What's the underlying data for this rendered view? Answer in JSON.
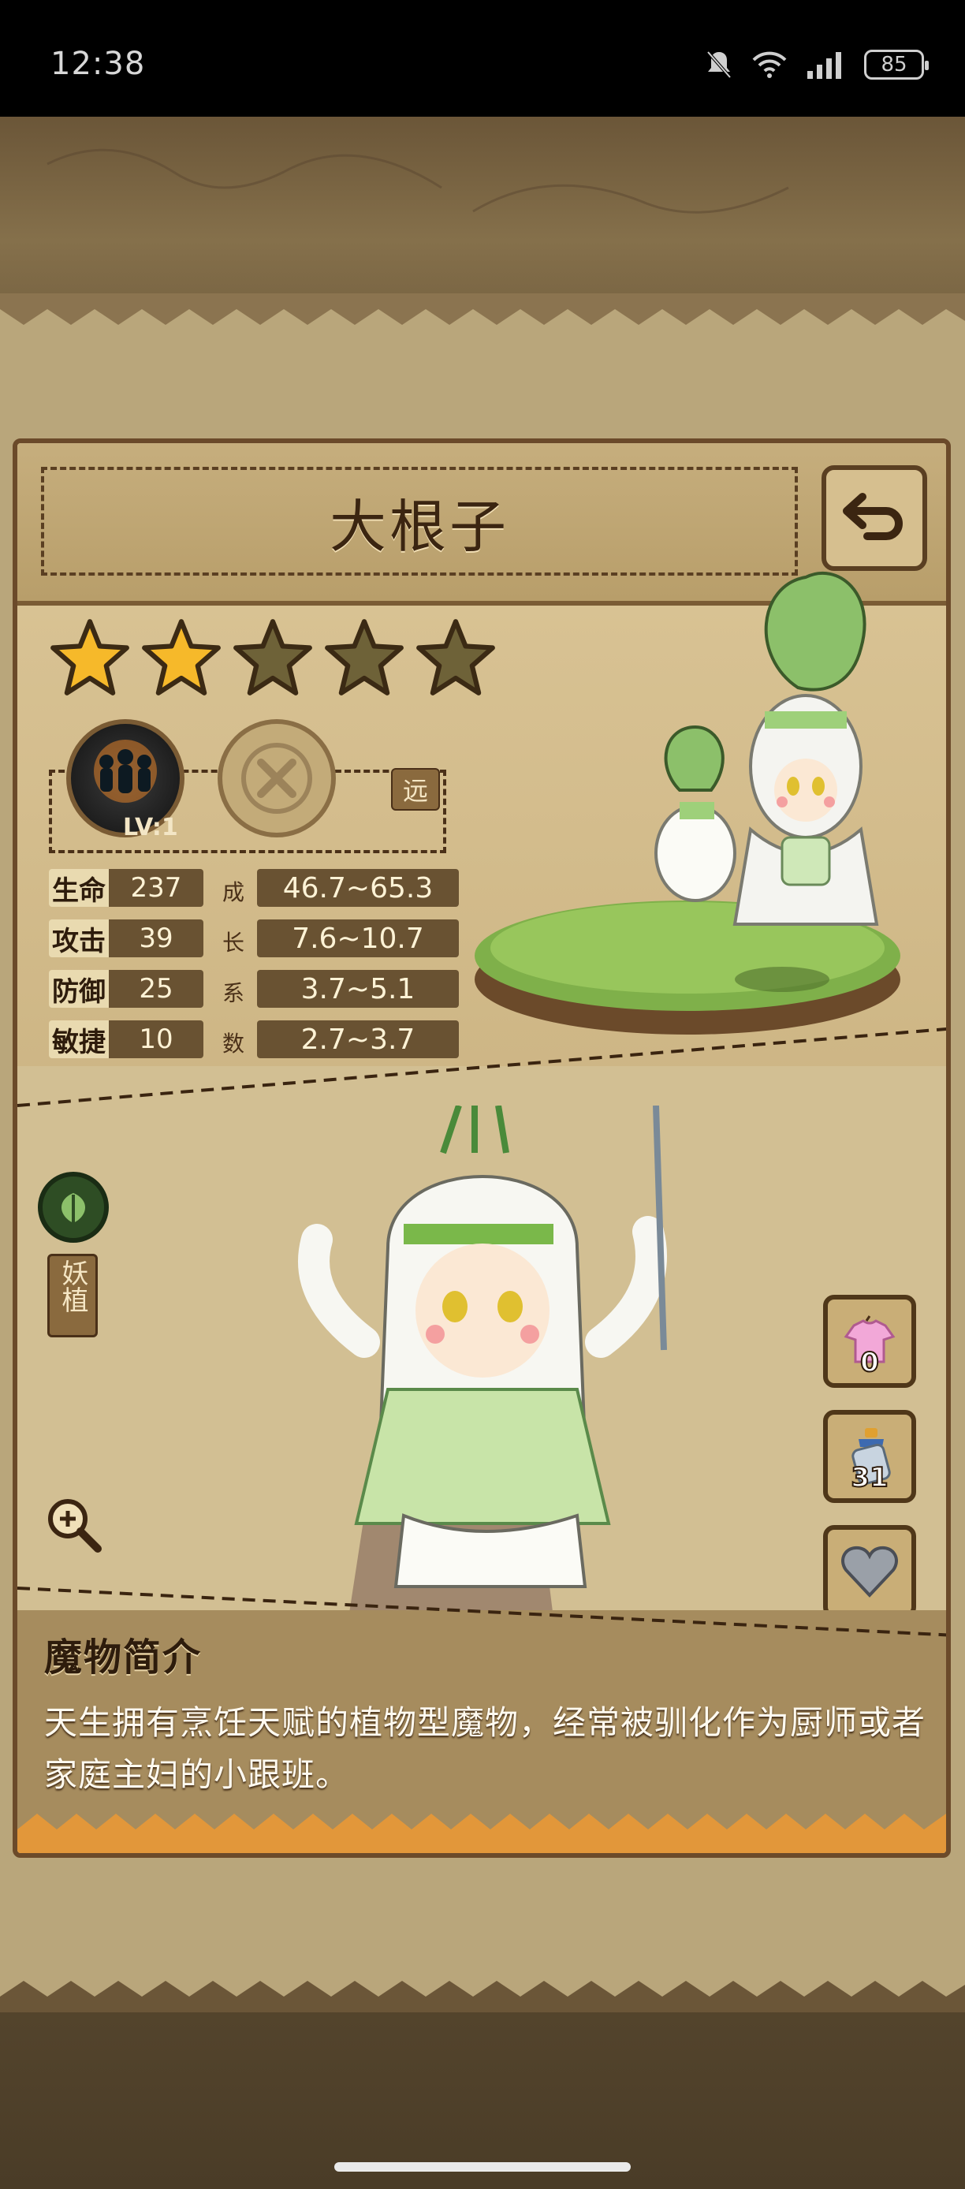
{
  "status_bar": {
    "time": "12:38",
    "battery": "85"
  },
  "monster": {
    "name": "大根子",
    "stars_total": 5,
    "stars_filled": 2,
    "skill_level": "LV:1",
    "range_tag": "远",
    "race": "妖植",
    "stats": [
      {
        "label": "生命",
        "value": "237",
        "growth": "46.7~65.3"
      },
      {
        "label": "攻击",
        "value": "39",
        "growth": "7.6~10.7"
      },
      {
        "label": "防御",
        "value": "25",
        "growth": "3.7~5.1"
      },
      {
        "label": "敏捷",
        "value": "10",
        "growth": "2.7~3.7"
      }
    ],
    "growth_label_chars": [
      "成",
      "长",
      "系",
      "数"
    ]
  },
  "side_buttons": {
    "outfit_count": "0",
    "bottle_count": "31"
  },
  "description": {
    "title": "魔物简介",
    "text": "天生拥有烹饪天赋的植物型魔物，经常被驯化作为厨师或者家庭主妇的小跟班。"
  },
  "icons": [
    "back-arrow-icon",
    "summon-skill-icon",
    "locked-skill-icon",
    "plant-leaf-icon",
    "zoom-icon",
    "dress-icon",
    "bottle-icon",
    "heart-icon"
  ]
}
